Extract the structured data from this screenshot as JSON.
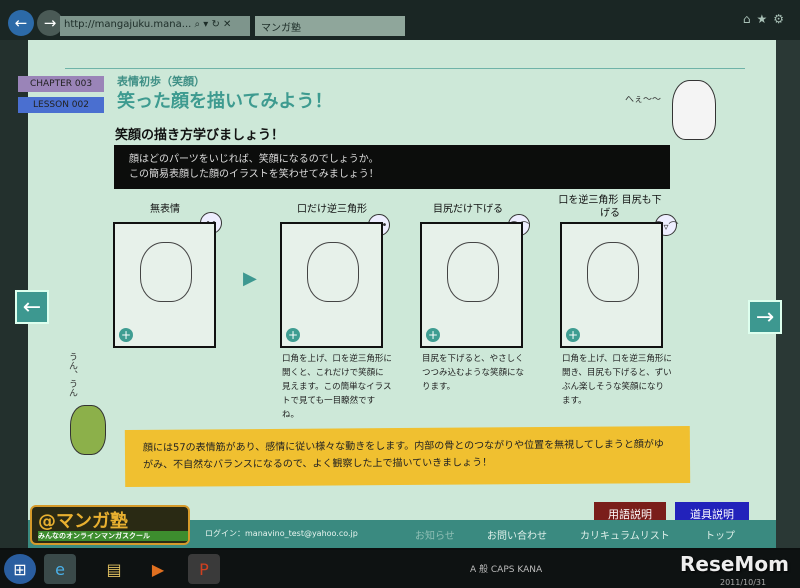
{
  "browser": {
    "url": "http://mangajuku.mana...",
    "tab_title": "マンガ塾",
    "addr_controls": "⌕ ▾ ↻ ✕",
    "tools": "⌂★⚙"
  },
  "lesson": {
    "chapter": "CHAPTER 003",
    "lesson": "LESSON 002",
    "subtitle": "表情初歩（笑顔）",
    "title": "笑った顔を描いてみよう！",
    "section_heading": "笑顔の描き方学びましょう！",
    "intro_line1": "顔はどのパーツをいじれば、笑顔になるのでしょうか。",
    "intro_line2": "この簡易表顔した顔のイラストを笑わせてみましょう！"
  },
  "rabbit_speech": "へぇ〜〜",
  "turtle_speech": "うん、うん",
  "panels": [
    {
      "label": "無表情",
      "desc": ""
    },
    {
      "label": "口だけ逆三角形",
      "desc": "口角を上げ、口を逆三角形に開くと、これだけで笑顔に見えます。この簡単なイラストで見ても一目瞭然ですね。"
    },
    {
      "label": "目尻だけ下げる",
      "desc": "目尻を下げると、やさしくつつみ込むような笑顔になります。"
    },
    {
      "label": "口を逆三角形 目尻も下げる",
      "desc": "口角を上げ、口を逆三角形に開き、目尻も下げると、ずいぶん楽しそうな笑顔になります。"
    }
  ],
  "note": "顔には57の表情筋があり、感情に従い様々な動きをします。内部の骨とのつながりや位置を無視してしまうと顔がゆがみ、不自然なバランスになるので、よく観察した上で描いていきましょう！",
  "footer": {
    "logo": "@マンガ塾",
    "logo_tagline": "みんなのオンラインマンガスクール",
    "login": "ログイン：manavino_test@yahoo.co.jp",
    "links": [
      "お知らせ",
      "お問い合わせ",
      "カリキュラムリスト",
      "トップ"
    ],
    "glossary": "用語説明",
    "tools_btn": "道具説明"
  },
  "taskbar": {
    "tray": "A 般  CAPS KANA",
    "date": "2011/10/31"
  },
  "watermark": "ReseMom"
}
